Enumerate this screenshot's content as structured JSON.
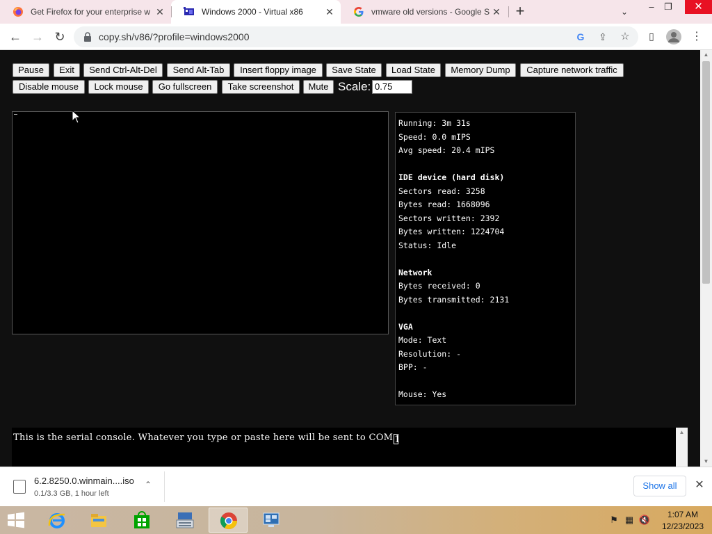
{
  "browser": {
    "tabs": [
      {
        "title": "Get Firefox for your enterprise w",
        "close": "✕"
      },
      {
        "title": "Windows 2000 - Virtual x86",
        "close": "✕"
      },
      {
        "title": "vmware old versions - Google Se",
        "close": "✕"
      }
    ],
    "new_tab": "+",
    "tab_search": "⌄",
    "window_controls": {
      "minimize": "–",
      "maximize": "❐",
      "close": "✕"
    },
    "nav": {
      "back": "←",
      "forward": "→",
      "reload": "↻"
    },
    "url": "copy.sh/v86/?profile=windows2000",
    "icons": {
      "lock": "🔒",
      "google": "G",
      "share": "⇪",
      "star": "☆",
      "sidepanel": "▯",
      "menu": "⋮"
    }
  },
  "controls": {
    "row1": [
      "Pause",
      "Exit",
      "Send Ctrl-Alt-Del",
      "Send Alt-Tab",
      "Insert floppy image",
      "Save State",
      "Load State",
      "Memory Dump",
      "Capture network traffic"
    ],
    "row2": [
      "Disable mouse",
      "Lock mouse",
      "Go fullscreen",
      "Take screenshot",
      "Mute"
    ],
    "scale_label": "Scale:",
    "scale_value": "0.75"
  },
  "stats": {
    "running": "Running: 3m 31s",
    "speed": "Speed: 0.0 mIPS",
    "avg_speed": "Avg speed: 20.4 mIPS",
    "ide_title": "IDE device (hard disk)",
    "sectors_read": "Sectors read: 3258",
    "bytes_read": "Bytes read: 1668096",
    "sectors_written": "Sectors written: 2392",
    "bytes_written": "Bytes written: 1224704",
    "status": "Status: Idle",
    "network_title": "Network",
    "bytes_received": "Bytes received: 0",
    "bytes_transmitted": "Bytes transmitted: 2131",
    "vga_title": "VGA",
    "mode": "Mode: Text",
    "resolution": "Resolution: -",
    "bpp": "BPP: -",
    "mouse": "Mouse: Yes"
  },
  "serial_console": {
    "text": "This is the serial console. Whatever you type or paste here will be sent to COM",
    "caret_char": "1"
  },
  "download": {
    "filename": "6.2.8250.0.winmain....iso",
    "status": "0.1/3.3 GB, 1 hour left",
    "chevron": "⌃",
    "show_all": "Show all",
    "close": "✕"
  },
  "taskbar": {
    "tray_icons": [
      "⚑",
      "▦",
      "🔇"
    ],
    "time": "1:07 AM",
    "date": "12/23/2023"
  },
  "colors": {
    "tabstrip": "#f6e5ea",
    "page_bg": "#101010",
    "close_red": "#e81123",
    "link_blue": "#1a73e8"
  }
}
